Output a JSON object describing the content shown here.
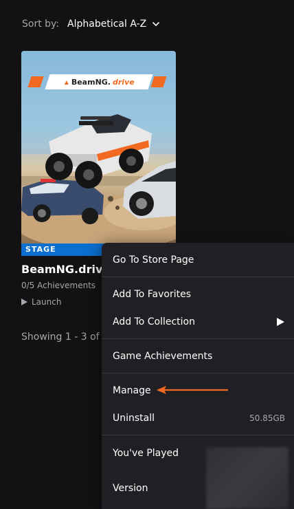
{
  "sort": {
    "label": "Sort by:",
    "value": "Alphabetical A-Z",
    "icon": "chevron-down-icon"
  },
  "game": {
    "cover_logo_brand": "BeamNG.",
    "cover_logo_accent": "drive",
    "badge": "STAGE",
    "title": "BeamNG.drive",
    "achievements": "0/5 Achievements",
    "launch_label": "Launch"
  },
  "library": {
    "showing": "Showing 1 - 3 of"
  },
  "context_menu": {
    "items": {
      "store_page": "Go To Store Page",
      "favorites": "Add To Favorites",
      "collection": "Add To Collection",
      "achievements": "Game Achievements",
      "manage": "Manage",
      "uninstall": "Uninstall",
      "uninstall_size": "50.85GB",
      "played": "You've Played",
      "version": "Version"
    }
  },
  "colors": {
    "background": "#121214",
    "menu_bg": "#202024",
    "badge": "#0b6fd0",
    "annotation_arrow": "#f26a21"
  }
}
